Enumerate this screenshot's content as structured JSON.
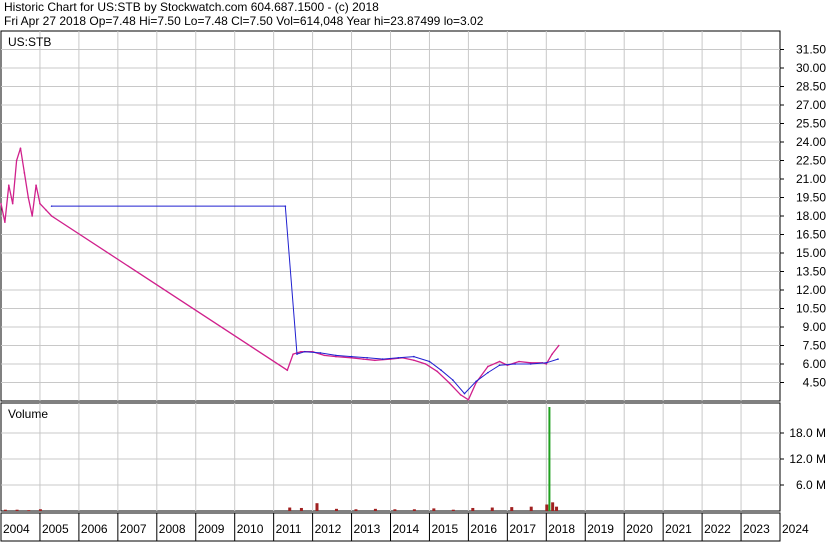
{
  "header": {
    "line1": "Historic Chart for US:STB by Stockwatch.com 604.687.1500 - (c) 2018",
    "line2": "Fri Apr 27 2018   Op=7.48   Hi=7.50   Lo=7.48   Cl=7.50   Vol=614,048   Year hi=23.87499  lo=3.02"
  },
  "chart_data": [
    {
      "type": "line",
      "title": "US:STB",
      "y_ticks": [
        "31.50",
        "30.00",
        "28.50",
        "27.00",
        "25.50",
        "24.00",
        "22.50",
        "21.00",
        "19.50",
        "18.00",
        "16.50",
        "15.00",
        "13.50",
        "12.00",
        "10.50",
        "9.00",
        "7.50",
        "6.00",
        "4.50"
      ],
      "ylim": [
        3.0,
        33.0
      ],
      "x_ticks": [
        "2004",
        "2005",
        "2006",
        "2007",
        "2008",
        "2009",
        "2010",
        "2011",
        "2012",
        "2013",
        "2014",
        "2015",
        "2016",
        "2017",
        "2018",
        "2019",
        "2020",
        "2021",
        "2022",
        "2023",
        "2024"
      ],
      "grid": true,
      "series": [
        {
          "color": "#d0208c",
          "x": [
            2004.0,
            2004.1,
            2004.2,
            2004.3,
            2004.4,
            2004.5,
            2004.6,
            2004.7,
            2004.8,
            2004.9,
            2005.0,
            2005.15,
            2005.3,
            2011.35,
            2011.5,
            2011.7,
            2012.0,
            2012.3,
            2012.6,
            2013.0,
            2013.3,
            2013.6,
            2014.0,
            2014.3,
            2014.6,
            2014.9,
            2015.2,
            2015.5,
            2015.8,
            2016.0,
            2016.2,
            2016.5,
            2016.8,
            2017.0,
            2017.3,
            2017.6,
            2017.9,
            2018.0,
            2018.15,
            2018.32
          ],
          "values": [
            19.0,
            17.5,
            20.5,
            19.0,
            22.5,
            23.5,
            21.5,
            19.5,
            18.0,
            20.5,
            19.0,
            18.5,
            18.0,
            5.5,
            6.8,
            7.0,
            7.0,
            6.7,
            6.6,
            6.5,
            6.4,
            6.3,
            6.4,
            6.5,
            6.3,
            6.0,
            5.4,
            4.5,
            3.5,
            3.1,
            4.5,
            5.8,
            6.2,
            5.9,
            6.2,
            6.1,
            6.1,
            6.0,
            6.8,
            7.5
          ]
        },
        {
          "color": "#2020d0",
          "x": [
            2005.3,
            2011.3,
            2011.6,
            2011.8,
            2012.2,
            2012.6,
            2013.0,
            2013.4,
            2013.8,
            2014.2,
            2014.6,
            2015.0,
            2015.3,
            2015.6,
            2015.9,
            2016.2,
            2016.5,
            2016.8,
            2017.2,
            2017.6,
            2018.0,
            2018.3
          ],
          "values": [
            18.8,
            18.8,
            6.8,
            7.0,
            6.9,
            6.7,
            6.6,
            6.5,
            6.4,
            6.5,
            6.6,
            6.2,
            5.5,
            4.7,
            3.6,
            4.6,
            5.3,
            5.9,
            6.0,
            6.0,
            6.1,
            6.4
          ]
        }
      ]
    },
    {
      "type": "bar",
      "title": "Volume",
      "y_ticks": [
        "18.0 M",
        "12.0 M",
        "6.0 M"
      ],
      "ylim": [
        0,
        24.0
      ],
      "x": [
        2004.1,
        2004.4,
        2004.7,
        2005.0,
        2011.4,
        2011.7,
        2012.1,
        2012.6,
        2013.1,
        2013.6,
        2014.1,
        2014.6,
        2015.1,
        2015.6,
        2016.1,
        2016.6,
        2017.1,
        2017.6,
        2018.0,
        2018.08,
        2018.15,
        2018.25
      ],
      "values": [
        0.3,
        0.3,
        0.2,
        0.4,
        0.8,
        0.7,
        1.8,
        0.5,
        0.4,
        0.5,
        0.4,
        0.4,
        0.6,
        0.3,
        0.7,
        0.8,
        0.9,
        1.0,
        1.5,
        24.0,
        2.0,
        1.0
      ]
    }
  ]
}
